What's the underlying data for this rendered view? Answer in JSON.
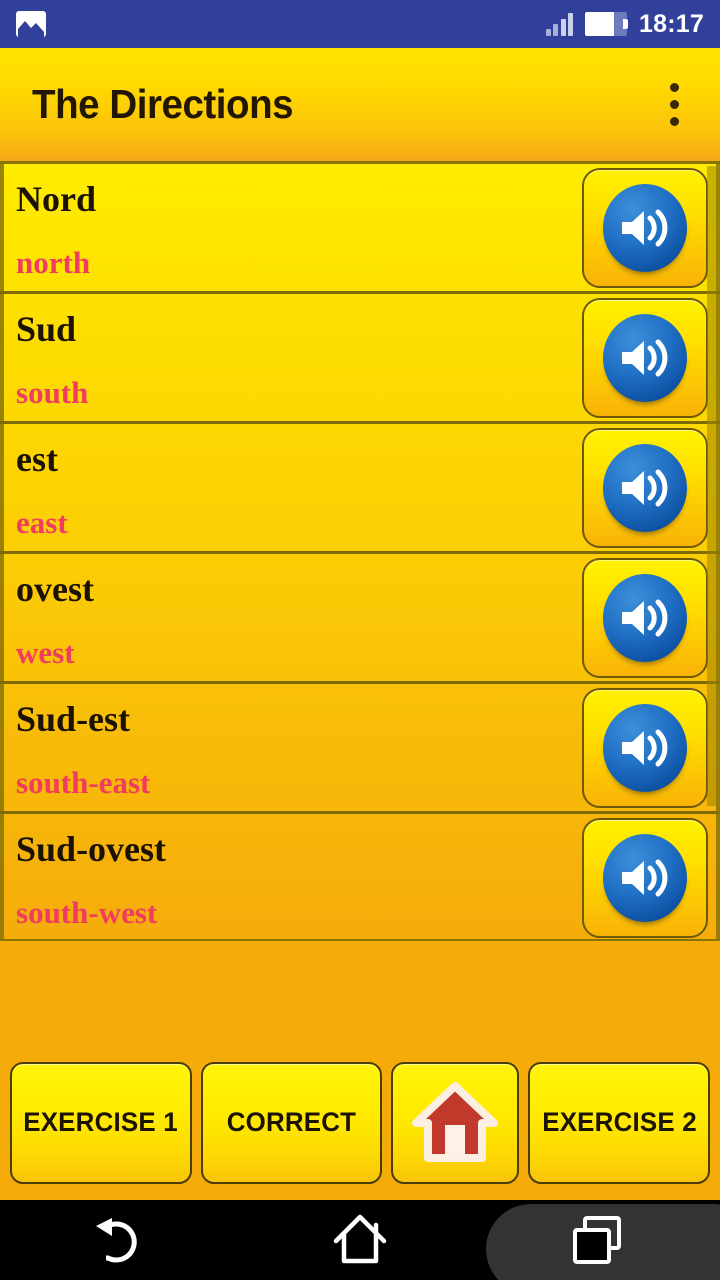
{
  "status_bar": {
    "notification_icon": "image-icon",
    "signal_icon": "signal-bars-icon",
    "battery_icon": "battery-icon",
    "time": "18:17"
  },
  "app_bar": {
    "title": "The Directions",
    "overflow_icon": "overflow-menu-icon"
  },
  "list": {
    "speaker_icon": "speaker-icon",
    "rows": [
      {
        "source": "Nord",
        "translation": "north"
      },
      {
        "source": "Sud",
        "translation": "south"
      },
      {
        "source": "est",
        "translation": "east"
      },
      {
        "source": "ovest",
        "translation": "west"
      },
      {
        "source": "Sud-est",
        "translation": "south-east"
      },
      {
        "source": "Sud-ovest",
        "translation": "south-west"
      }
    ]
  },
  "bottom_bar": {
    "exercise1_label": "EXERCISE 1",
    "correct_label": "CORRECT",
    "home_icon": "home-house-icon",
    "exercise2_label": "EXERCISE 2"
  },
  "nav_bar": {
    "back_icon": "back-arrow-icon",
    "home_icon": "home-outline-icon",
    "recents_icon": "recents-squares-icon"
  },
  "colors": {
    "status_bar_bg": "#31409B",
    "accent_yellow": "#FFE400",
    "accent_orange": "#F5AC0B",
    "translation_pink": "#F03C5E",
    "speaker_blue": "#1F6FC4",
    "house_red": "#C0392B",
    "text_dark": "#1B1203"
  }
}
